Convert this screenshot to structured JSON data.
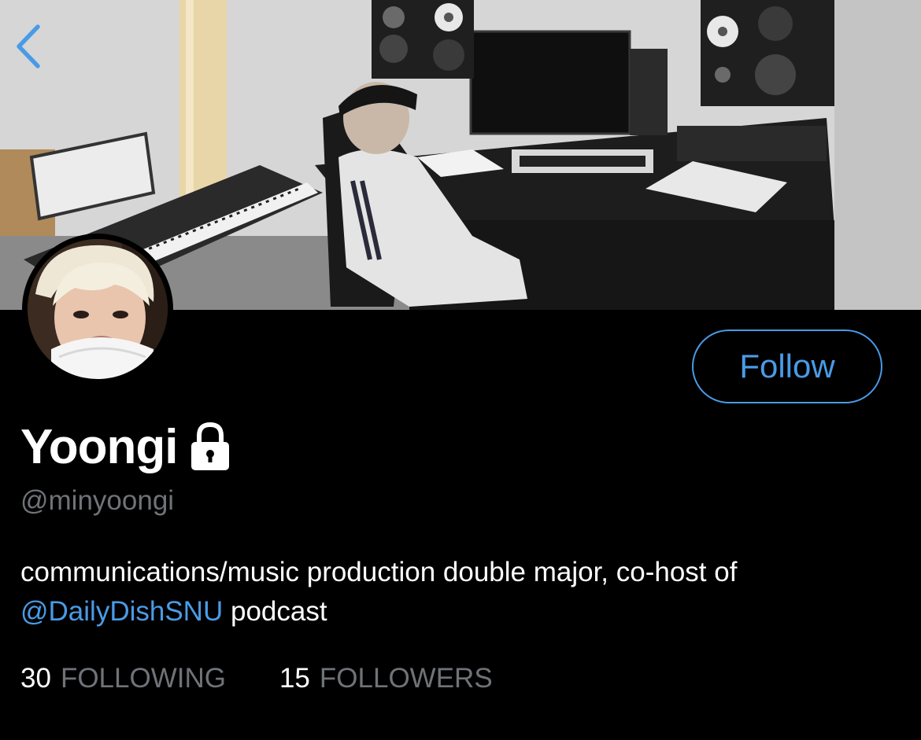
{
  "header": {
    "back_icon": "chevron-left-icon"
  },
  "profile": {
    "display_name": "Yoongi",
    "protected_icon": "lock-icon",
    "handle": "@minyoongi",
    "bio": {
      "before": "communications/music production double major, co-host of ",
      "mention": "@DailyDishSNU",
      "after": " podcast"
    },
    "follow_label": "Follow"
  },
  "stats": {
    "following_count": "30",
    "following_label": "FOLLOWING",
    "followers_count": "15",
    "followers_label": "FOLLOWERS"
  },
  "colors": {
    "background": "#000000",
    "accent": "#4a9be6",
    "secondary_text": "#6f7378",
    "primary_text": "#ffffff"
  }
}
